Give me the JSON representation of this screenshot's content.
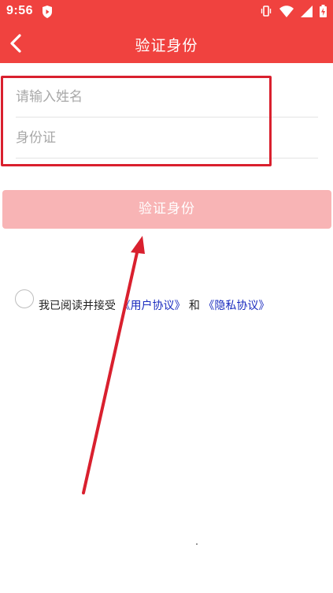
{
  "status_bar": {
    "time": "9:56",
    "icons": [
      "play-shield-icon",
      "vibrate-icon",
      "wifi-icon",
      "signal-icon",
      "battery-charging-icon"
    ]
  },
  "app_bar": {
    "title": "验证身份",
    "back_icon": "chevron-left-icon"
  },
  "form": {
    "name_placeholder": "请输入姓名",
    "id_placeholder": "身份证"
  },
  "verify_button": {
    "label": "验证身份"
  },
  "agreement": {
    "prefix": "我已阅读并接受",
    "user_agreement": "《用户协议》",
    "and": "和",
    "privacy_policy": "《隐私协议》",
    "checked": false
  },
  "colors": {
    "primary": "#f0423f",
    "button_disabled": "#f8b4b5",
    "link": "#1a2bbf",
    "annotation": "#d9202e"
  }
}
